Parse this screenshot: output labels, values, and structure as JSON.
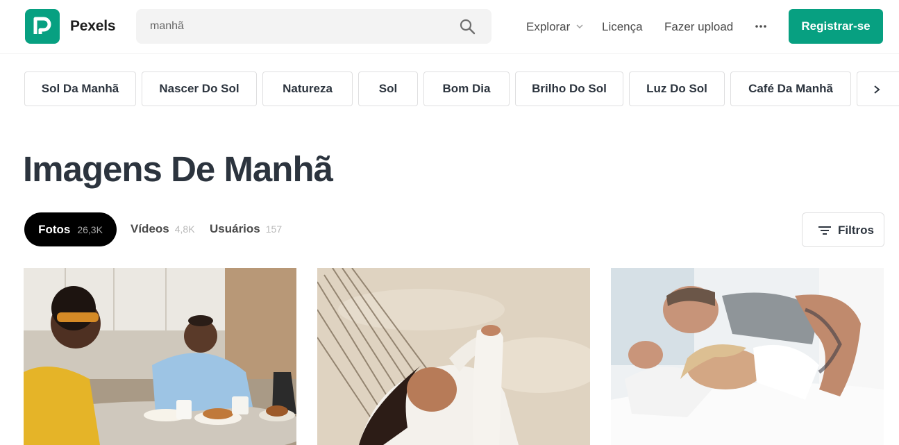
{
  "header": {
    "logo_text": "Pexels",
    "search": {
      "value": "manhã",
      "placeholder": "manhã"
    },
    "nav": {
      "explore": "Explorar",
      "license": "Licença",
      "upload": "Fazer upload"
    },
    "register_label": "Registrar-se",
    "brand_color": "#07a081"
  },
  "tags": [
    "Sol Da Manhã",
    "Nascer Do Sol",
    "Natureza",
    "Sol",
    "Bom Dia",
    "Brilho Do Sol",
    "Luz Do Sol",
    "Café Da Manhã"
  ],
  "title": "Imagens De Manhã",
  "tabs": [
    {
      "label": "Fotos",
      "count": "26,3K",
      "active": true
    },
    {
      "label": "Vídeos",
      "count": "4,8K",
      "active": false
    },
    {
      "label": "Usuários",
      "count": "157",
      "active": false
    }
  ],
  "filters_label": "Filtros",
  "icons": [
    "search-icon",
    "chevron-down-icon",
    "more-icon",
    "chevron-right-icon",
    "filter-icon"
  ]
}
